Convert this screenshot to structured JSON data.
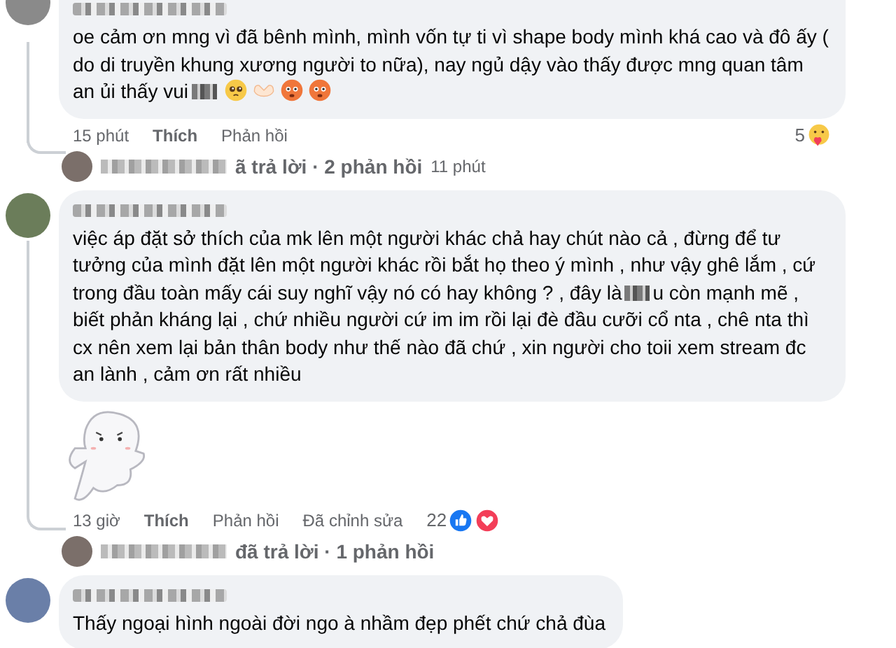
{
  "comments": [
    {
      "top_cut": true,
      "sticker": false,
      "segments": [
        {
          "kind": "text",
          "text": "oe cảm ơn mng vì đã bênh mình, mình vốn tự ti vì shape body mình khá cao và đô ấy ( do di truyền khung xương người to nữa), nay ngủ dậy vào thấy được mng quan tâm an ủi thấy vui"
        },
        {
          "kind": "blur"
        },
        {
          "kind": "crying-emoji"
        },
        {
          "kind": "heart-hands-emoji"
        },
        {
          "kind": "flushed-emoji"
        },
        {
          "kind": "flushed-emoji"
        }
      ],
      "actions": {
        "time": "15 phút",
        "like": "Thích",
        "reply": "Phản hồi"
      },
      "reactions": {
        "kind": "trailing",
        "count": "5",
        "icons": [
          {
            "kind": "care"
          }
        ]
      },
      "reply_summary": {
        "text": "ã trả lời · 2 phản hồi",
        "time": "11 phút"
      }
    },
    {
      "top_cut": false,
      "segments": [
        {
          "kind": "text",
          "text": "việc áp đặt sở thích của mk lên một người khác chả hay chút nào cả , đừng để tư tưởng của mình đặt lên một người khác rồi bắt họ theo ý mình , như vậy ghê lắm , cứ trong đầu toàn mấy cái suy nghĩ vậy nó có hay không ? , đây là"
        },
        {
          "kind": "blur"
        },
        {
          "kind": "text",
          "text": "u còn mạnh mẽ , biết phản kháng lại , chứ nhiều người cứ im im rồi lại đè đầu cưỡi cổ nta , chê nta thì cx nên xem lại bản thân body như thế nào đã chứ , xin người cho toii xem stream đc an lành , cảm ơn rất nhiều"
        }
      ],
      "sticker": true,
      "actions": {
        "time": "13 giờ",
        "like": "Thích",
        "reply": "Phản hồi",
        "edited": "Đã chỉnh sửa"
      },
      "reactions": {
        "kind": "inline",
        "count": "22",
        "icons": [
          {
            "kind": "like"
          },
          {
            "kind": "love"
          }
        ]
      },
      "reply_summary": {
        "text": "đã trả lời · 1 phản hồi"
      }
    },
    {
      "top_cut": false,
      "sticker": false,
      "segments": [
        {
          "kind": "text",
          "text": "Thấy ngoại hình ngoài đời ngo à nhầm đẹp phết chứ chả đùa"
        }
      ]
    }
  ]
}
